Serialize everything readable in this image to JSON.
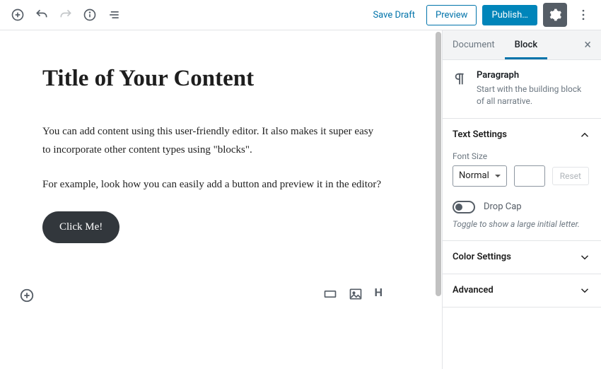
{
  "topbar": {
    "save_draft": "Save Draft",
    "preview": "Preview",
    "publish": "Publish…"
  },
  "editor": {
    "title": "Title of Your Content",
    "p1": "You can add content using this user-friendly editor. It also makes it super easy to incorporate other content types using \"blocks\".",
    "p2": "For example, look how you can easily add a button and preview it in the editor?",
    "button_label": "Click Me!"
  },
  "sidebar": {
    "tabs": {
      "document": "Document",
      "block": "Block"
    },
    "block": {
      "title": "Paragraph",
      "desc": "Start with the building block of all narrative."
    },
    "panels": {
      "text_settings": "Text Settings",
      "font_size_label": "Font Size",
      "font_size_value": "Normal",
      "reset": "Reset",
      "drop_cap": "Drop Cap",
      "drop_cap_hint": "Toggle to show a large initial letter.",
      "color_settings": "Color Settings",
      "advanced": "Advanced"
    }
  },
  "block_types": {
    "heading": "H"
  }
}
